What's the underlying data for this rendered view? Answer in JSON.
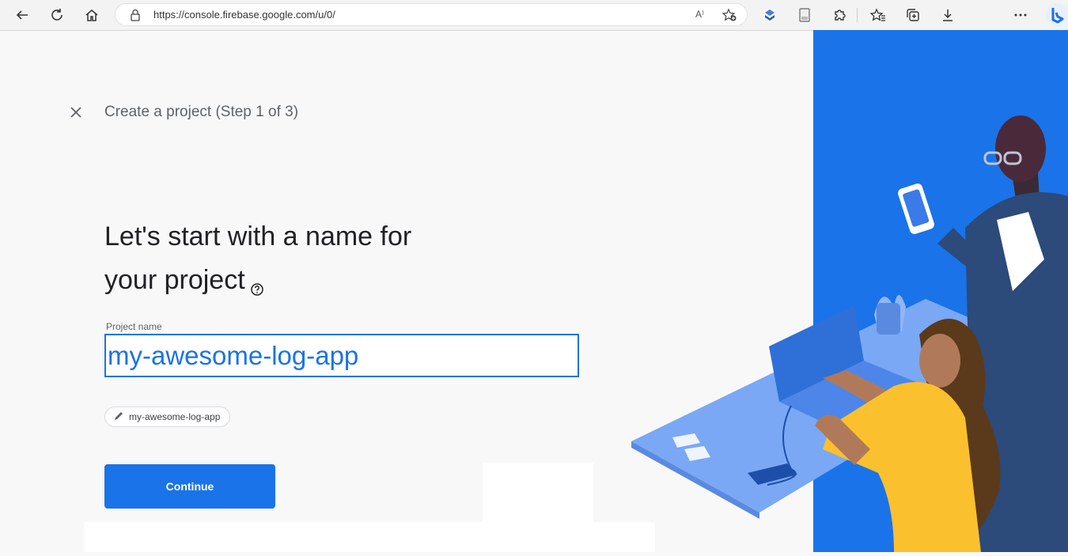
{
  "browser": {
    "url": "https://console.firebase.google.com/u/0/",
    "read_aloud_label": "A⁾"
  },
  "page": {
    "step_title": "Create a project (Step 1 of 3)",
    "heading_line1": "Let's start with a name for",
    "heading_line2": "your project",
    "field_label": "Project name",
    "project_name_value": "my-awesome-log-app",
    "project_id_chip": "my-awesome-log-app",
    "continue_label": "Continue"
  },
  "colors": {
    "accent": "#1a73e8",
    "panel_blue": "#1a73e8",
    "text_dark": "#202124",
    "text_muted": "#5f6368"
  },
  "icons": [
    "back-icon",
    "refresh-icon",
    "home-icon",
    "lock-icon",
    "read-aloud-icon",
    "add-favorite-icon",
    "extension-icon",
    "reader-icon",
    "puzzle-icon",
    "favorites-icon",
    "collections-icon",
    "download-icon",
    "more-icon",
    "bing-icon",
    "close-icon",
    "help-icon",
    "pencil-icon"
  ]
}
